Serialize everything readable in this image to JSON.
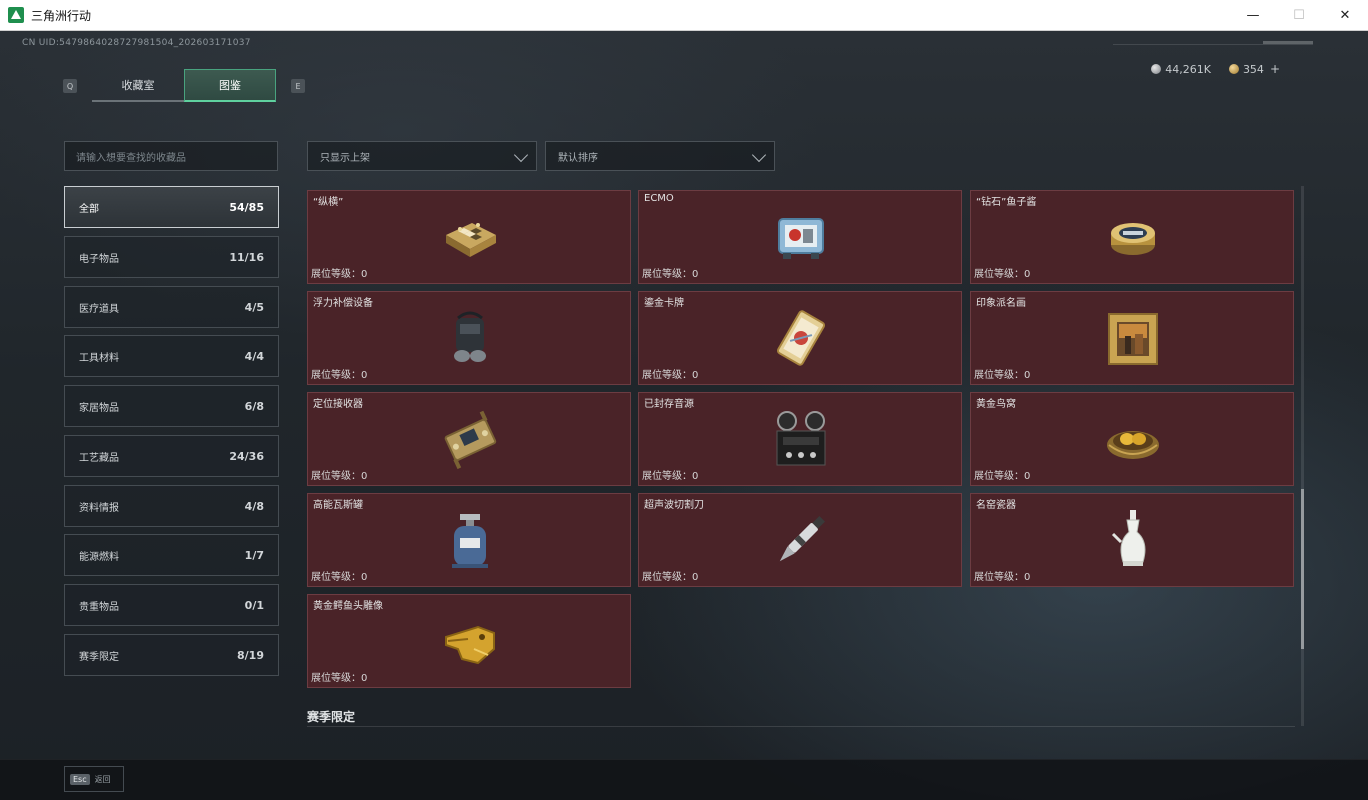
{
  "window": {
    "title": "三角洲行动",
    "min": "—",
    "max": "☐",
    "close": "✕"
  },
  "uid": "CN UID:5479864028727981504_202603171037",
  "currency": {
    "silver": "44,261K",
    "gold": "354",
    "plus": "+"
  },
  "tabs": {
    "left_key": "Q",
    "right_key": "E",
    "items": [
      {
        "label": "收藏室"
      },
      {
        "label": "图鉴"
      }
    ]
  },
  "search": {
    "placeholder": "请输入想要查找的收藏品"
  },
  "categories": [
    {
      "label": "全部",
      "count": "54/85"
    },
    {
      "label": "电子物品",
      "count": "11/16"
    },
    {
      "label": "医疗道具",
      "count": "4/5"
    },
    {
      "label": "工具材料",
      "count": "4/4"
    },
    {
      "label": "家居物品",
      "count": "6/8"
    },
    {
      "label": "工艺藏品",
      "count": "24/36"
    },
    {
      "label": "资料情报",
      "count": "4/8"
    },
    {
      "label": "能源燃料",
      "count": "1/7"
    },
    {
      "label": "贵重物品",
      "count": "0/1"
    },
    {
      "label": "赛季限定",
      "count": "8/19"
    }
  ],
  "filters": {
    "shelf": "只显示上架",
    "sort": "默认排序"
  },
  "items": [
    {
      "name": "“纵横”",
      "level": "展位等级：0",
      "icon": "chessboard-icon"
    },
    {
      "name": "ECMO",
      "level": "展位等级：0",
      "icon": "ecmo-machine-icon"
    },
    {
      "name": "“钻石”鱼子酱",
      "level": "展位等级：0",
      "icon": "caviar-tin-icon"
    },
    {
      "name": "浮力补偿设备",
      "level": "展位等级：0",
      "icon": "buoyancy-device-icon"
    },
    {
      "name": "鎏金卡牌",
      "level": "展位等级：0",
      "icon": "gilded-card-icon"
    },
    {
      "name": "印象派名画",
      "level": "展位等级：0",
      "icon": "painting-icon"
    },
    {
      "name": "定位接收器",
      "level": "展位等级：0",
      "icon": "gps-receiver-icon"
    },
    {
      "name": "已封存音源",
      "level": "展位等级：0",
      "icon": "reel-recorder-icon"
    },
    {
      "name": "黄金鸟窝",
      "level": "展位等级：0",
      "icon": "golden-nest-icon"
    },
    {
      "name": "高能瓦斯罐",
      "level": "展位等级：0",
      "icon": "gas-canister-icon"
    },
    {
      "name": "超声波切割刀",
      "level": "展位等级：0",
      "icon": "ultrasonic-knife-icon"
    },
    {
      "name": "名窑瓷器",
      "level": "展位等级：0",
      "icon": "porcelain-vase-icon"
    },
    {
      "name": "黄金鳄鱼头雕像",
      "level": "展位等级：0",
      "icon": "gold-croc-head-icon"
    }
  ],
  "section": {
    "title": "赛季限定"
  },
  "footer": {
    "key": "Esc",
    "label": "返回"
  },
  "colors": {
    "card_bg": "#4a2328",
    "tab_accent": "#5fd19f"
  }
}
